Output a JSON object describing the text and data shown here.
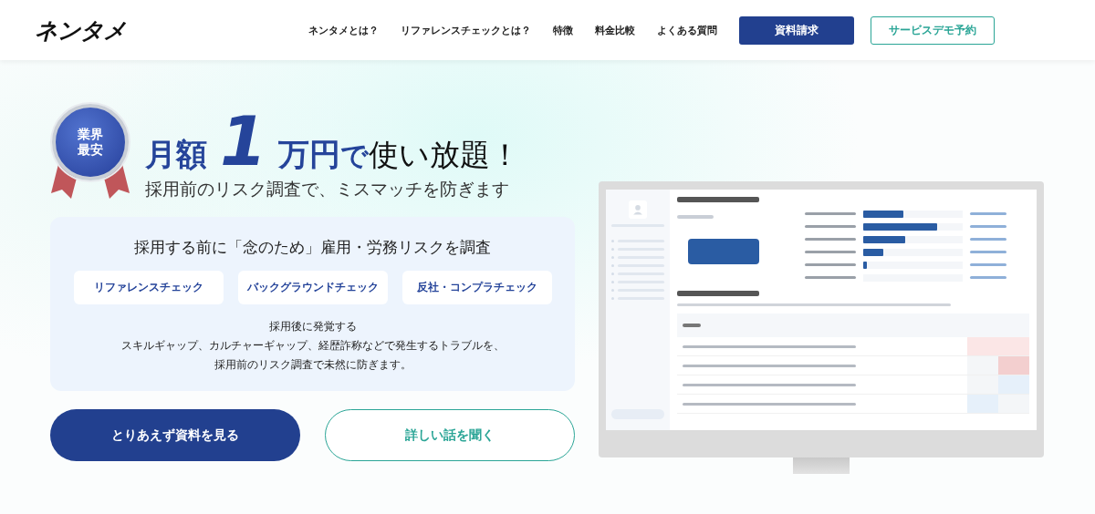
{
  "header": {
    "logo": "ネンタメ",
    "nav": [
      {
        "label": "ネンタメとは？"
      },
      {
        "label": "リファレンスチェックとは？"
      },
      {
        "label": "特徴"
      },
      {
        "label": "料金比較"
      },
      {
        "label": "よくある質問"
      }
    ],
    "buttons": [
      {
        "label": "資料請求",
        "kind": "primary"
      },
      {
        "label": "サービスデモ予約",
        "kind": "outline"
      }
    ]
  },
  "hero": {
    "badge": [
      "業界",
      "最安"
    ],
    "headline": [
      {
        "text": "月額",
        "kind": "accent"
      },
      {
        "text": "1",
        "kind": "big"
      },
      {
        "text": "万円",
        "kind": "accent"
      },
      {
        "text": "で",
        "kind": "small-accent"
      },
      {
        "text": "使い放題！",
        "kind": "plain"
      }
    ],
    "subheadline": "採用前のリスク調査で、ミスマッチを防ぎます",
    "card": {
      "title": "採用する前に「念のため」雇用・労務リスクを調査",
      "tags": [
        "リファレンスチェック",
        "バックグラウンドチェック",
        "反社・コンプラチェック"
      ],
      "description": [
        "採用後に発覚する",
        "スキルギャップ、カルチャーギャップ、経歴詐称などで発生するトラブルを、",
        "採用前のリスク調査で未然に防ぎます。"
      ]
    },
    "ctas": [
      {
        "label": "とりあえず資料を見る",
        "kind": "primary"
      },
      {
        "label": "詳しい話を聞く",
        "kind": "outline"
      }
    ]
  }
}
